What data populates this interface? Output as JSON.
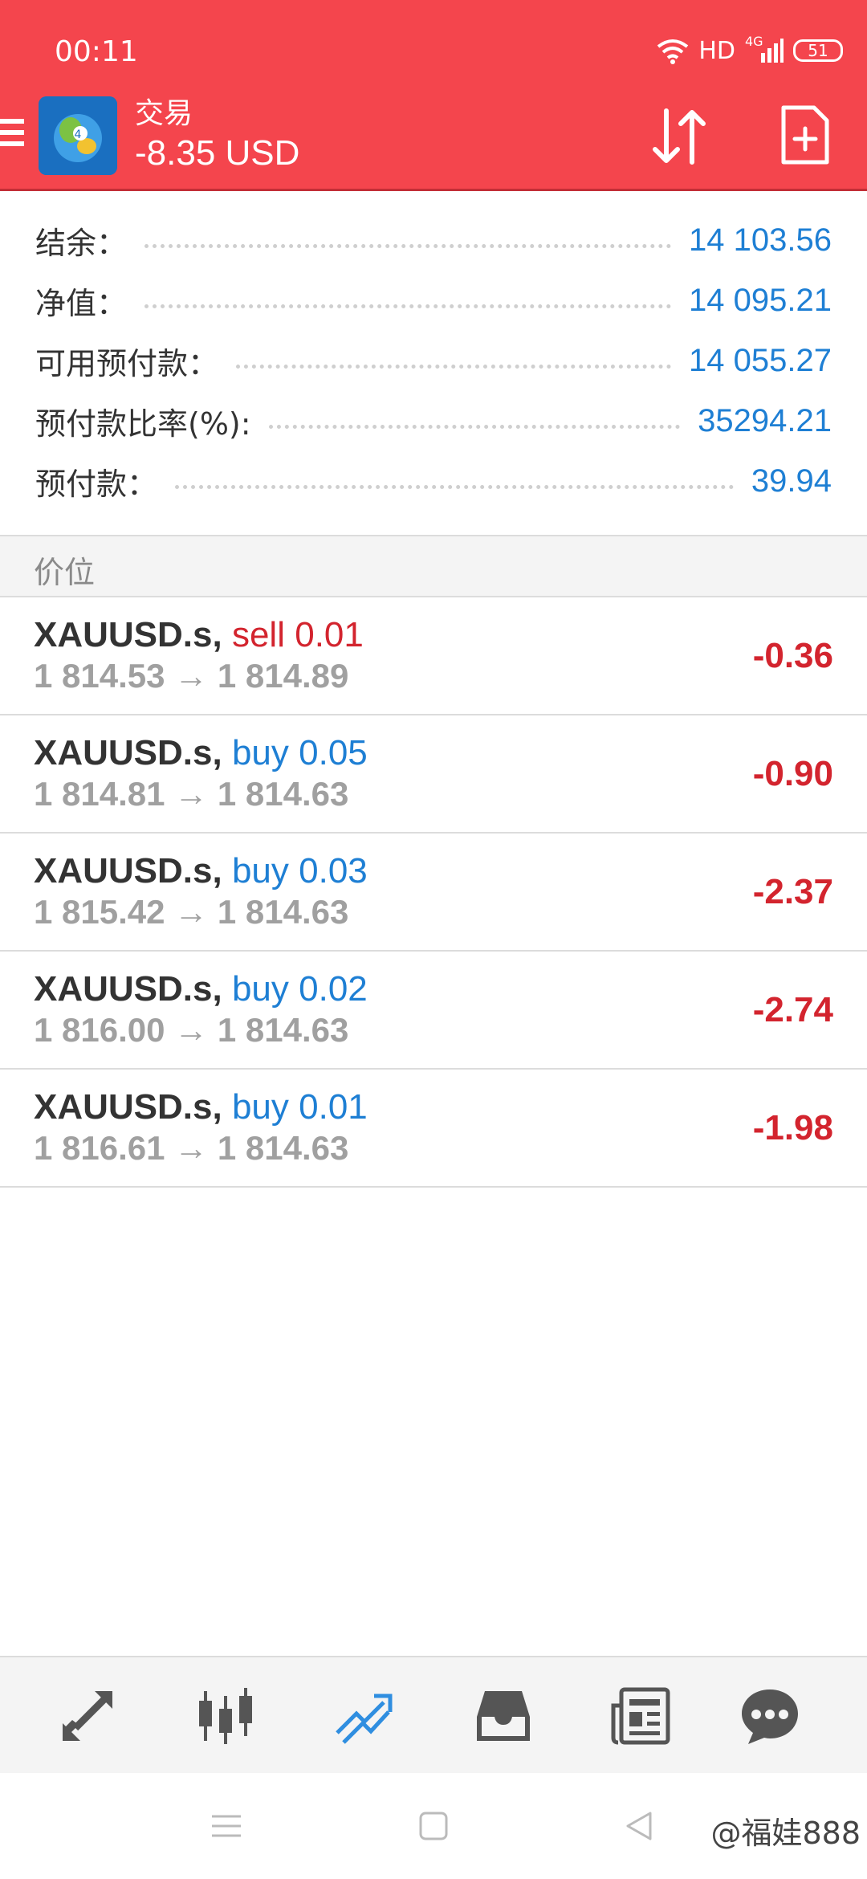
{
  "status_bar": {
    "time": "00:11",
    "network": "HD",
    "signal_label": "4G",
    "battery": "51"
  },
  "header": {
    "title": "交易",
    "subtitle": "-8.35 USD",
    "background_color": "#f4454d"
  },
  "summary": [
    {
      "label": "结余：",
      "value": "14 103.56"
    },
    {
      "label": "净值：",
      "value": "14 095.21"
    },
    {
      "label": "可用预付款：",
      "value": "14 055.27"
    },
    {
      "label": "预付款比率(%):",
      "value": "35294.21"
    },
    {
      "label": "预付款：",
      "value": "39.94"
    }
  ],
  "section_title": "价位",
  "positions": [
    {
      "symbol": "XAUUSD.s,",
      "type": "sell",
      "volume": "0.01",
      "open_price": "1 814.53",
      "arrow": "→",
      "current_price": "1 814.89",
      "profit": "-0.36"
    },
    {
      "symbol": "XAUUSD.s,",
      "type": "buy",
      "volume": "0.05",
      "open_price": "1 814.81",
      "arrow": "→",
      "current_price": "1 814.63",
      "profit": "-0.90"
    },
    {
      "symbol": "XAUUSD.s,",
      "type": "buy",
      "volume": "0.03",
      "open_price": "1 815.42",
      "arrow": "→",
      "current_price": "1 814.63",
      "profit": "-2.37"
    },
    {
      "symbol": "XAUUSD.s,",
      "type": "buy",
      "volume": "0.02",
      "open_price": "1 816.00",
      "arrow": "→",
      "current_price": "1 814.63",
      "profit": "-2.74"
    },
    {
      "symbol": "XAUUSD.s,",
      "type": "buy",
      "volume": "0.01",
      "open_price": "1 816.61",
      "arrow": "→",
      "current_price": "1 814.63",
      "profit": "-1.98"
    }
  ],
  "bottom_nav": {
    "items": [
      "quotes-icon",
      "chart-icon",
      "trade-icon",
      "history-icon",
      "news-icon",
      "messages-icon"
    ],
    "active": "trade-icon",
    "active_color": "#2f8ee0"
  },
  "watermark": "@福娃888"
}
